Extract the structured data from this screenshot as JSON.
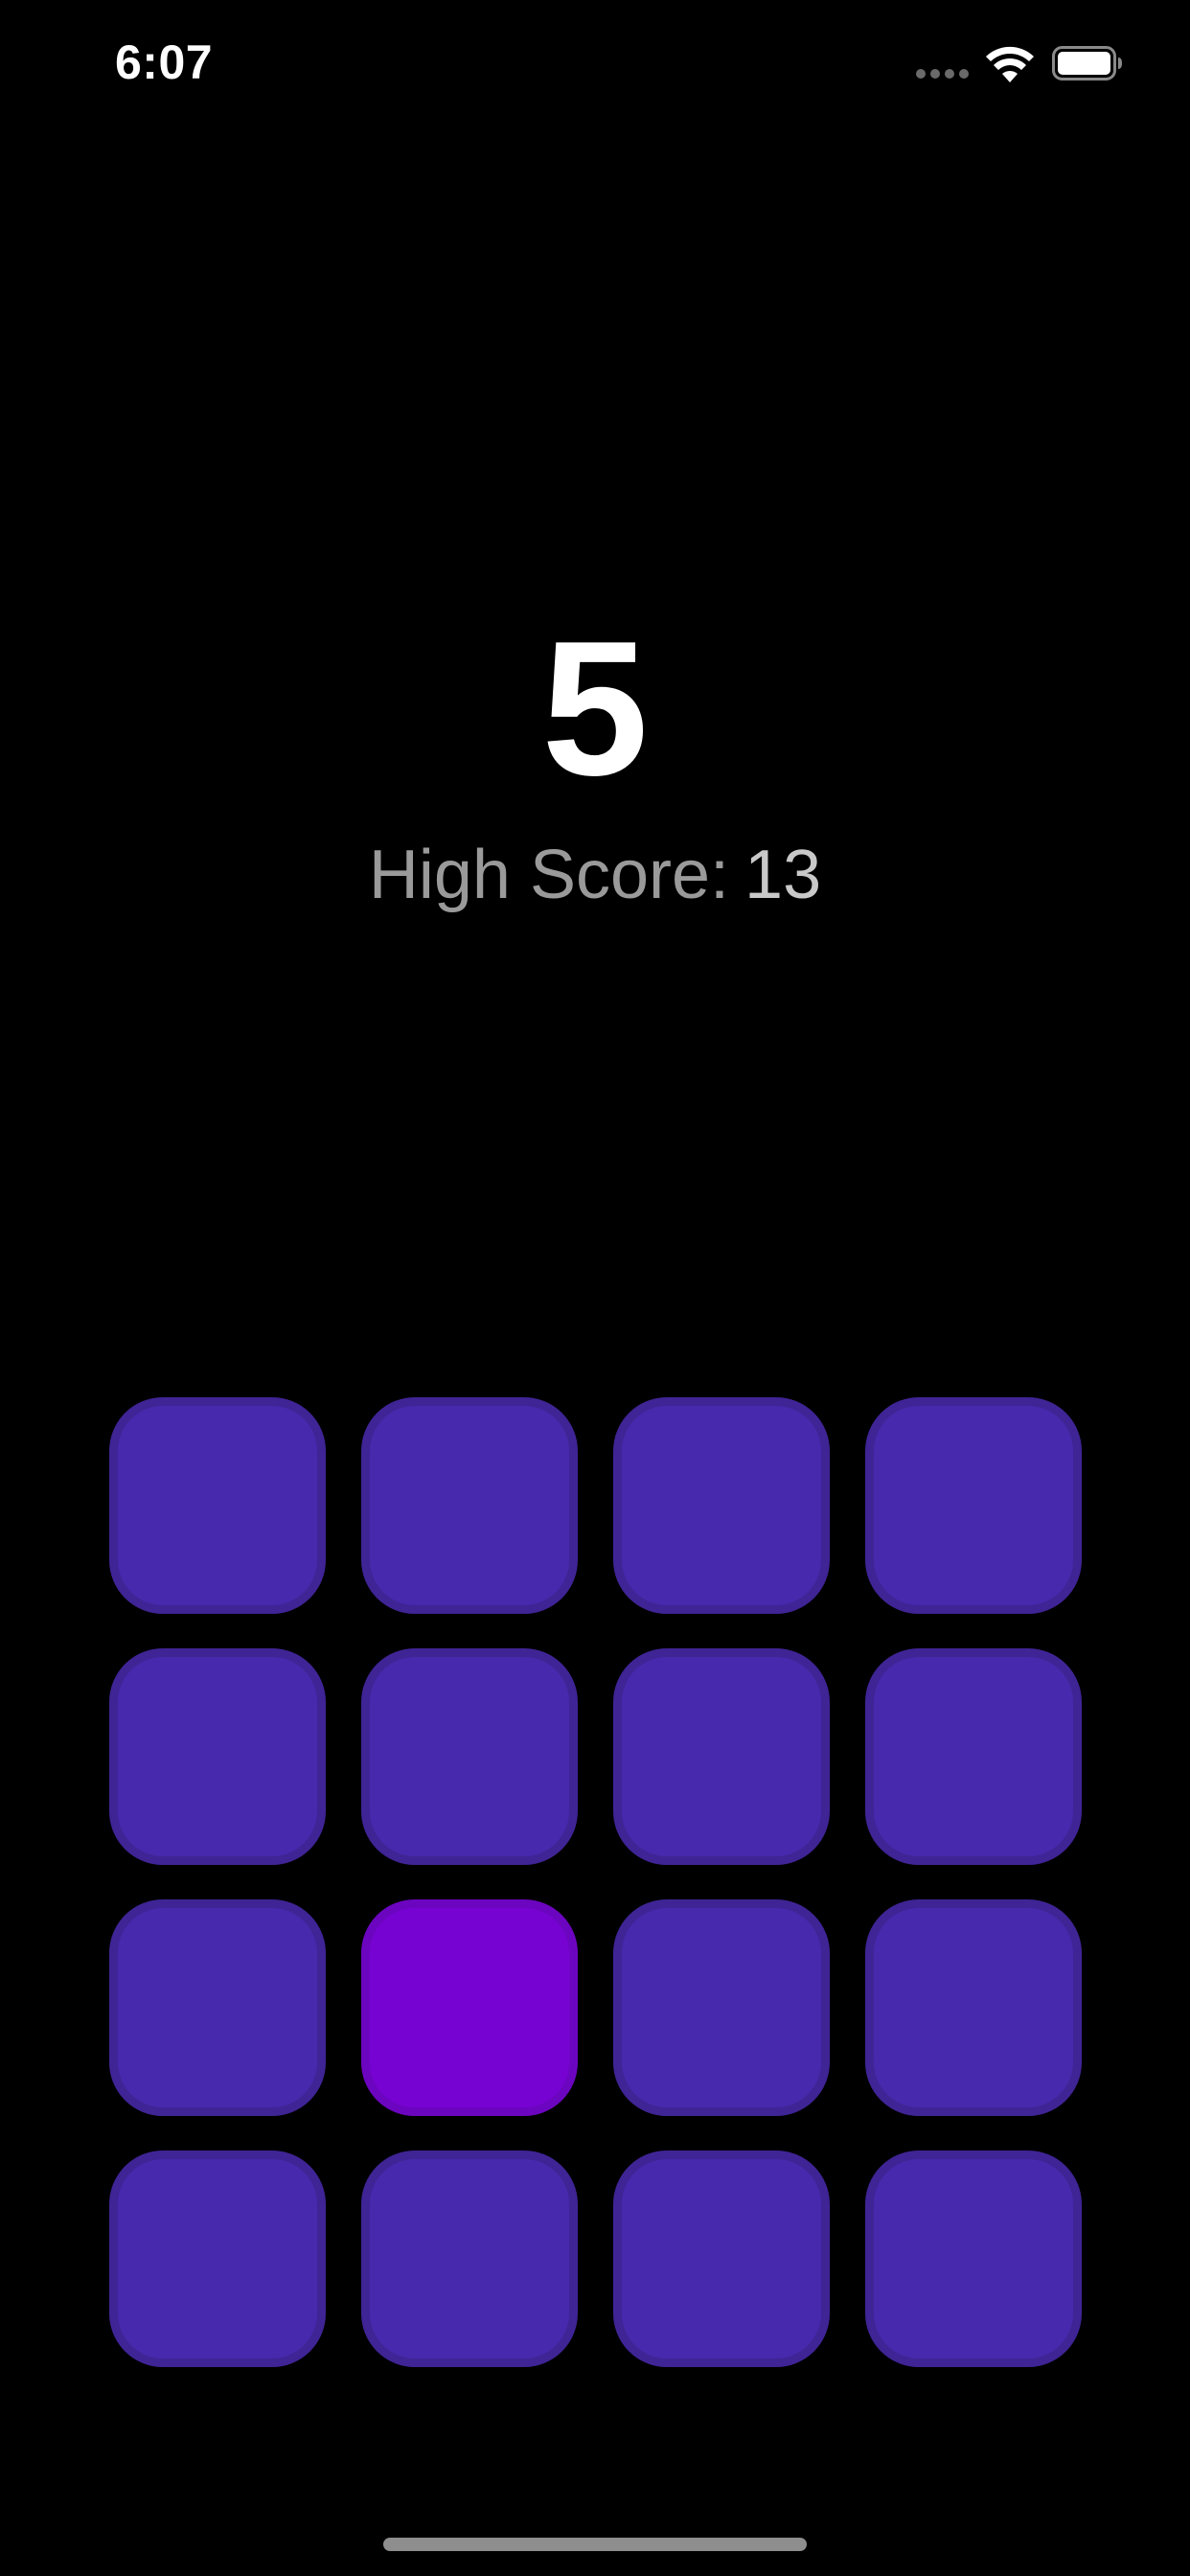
{
  "status_bar": {
    "time": "6:07",
    "signal_icon": "signal-dots-icon",
    "wifi_icon": "wifi-icon",
    "battery_icon": "battery-icon",
    "battery_level": 1.0
  },
  "game": {
    "score": "5",
    "high_score_label": "High Score:",
    "high_score_value": "13"
  },
  "grid": {
    "rows": 4,
    "columns": 4,
    "active_tile": {
      "row": 3,
      "column": 2
    },
    "tile_color": "#4729ad",
    "active_tile_color": "#7703d3"
  },
  "colors": {
    "background": "#000000",
    "score_text": "#ffffff",
    "high_score_text": "#9a9a9a"
  }
}
